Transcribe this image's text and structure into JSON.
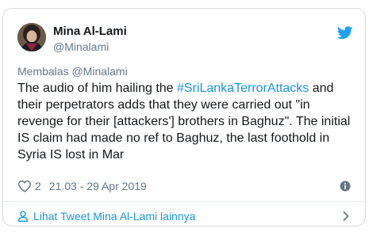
{
  "author": {
    "name": "Mina Al-Lami",
    "handle": "@Minalami"
  },
  "tweet": {
    "reply_label": "Membalas @Minalami",
    "text_before": "The audio of him hailing the ",
    "hashtag": "#SriLankaTerrorAttacks",
    "text_after": " and their perpetrators adds that they were carried out \"in revenge for their [attackers'] brothers in Baghuz\". The initial IS claim had made no ref to Baghuz, the last foothold in Syria IS lost in Mar"
  },
  "meta": {
    "like_count": "2",
    "timestamp": "21.03 - 29 Apr 2019"
  },
  "footer": {
    "link_label": "Lihat Tweet Mina Al-Lami lainnya"
  },
  "colors": {
    "accent": "#1b95e0",
    "twitter_blue": "#1da1f2",
    "text_primary": "#14171a",
    "text_secondary": "#657786",
    "border": "#d7dce0"
  },
  "icons": {
    "brand": "twitter-bird-icon",
    "like": "heart-icon",
    "info": "info-icon",
    "profile": "person-icon",
    "footer_chevron": "chevron-right-icon"
  }
}
